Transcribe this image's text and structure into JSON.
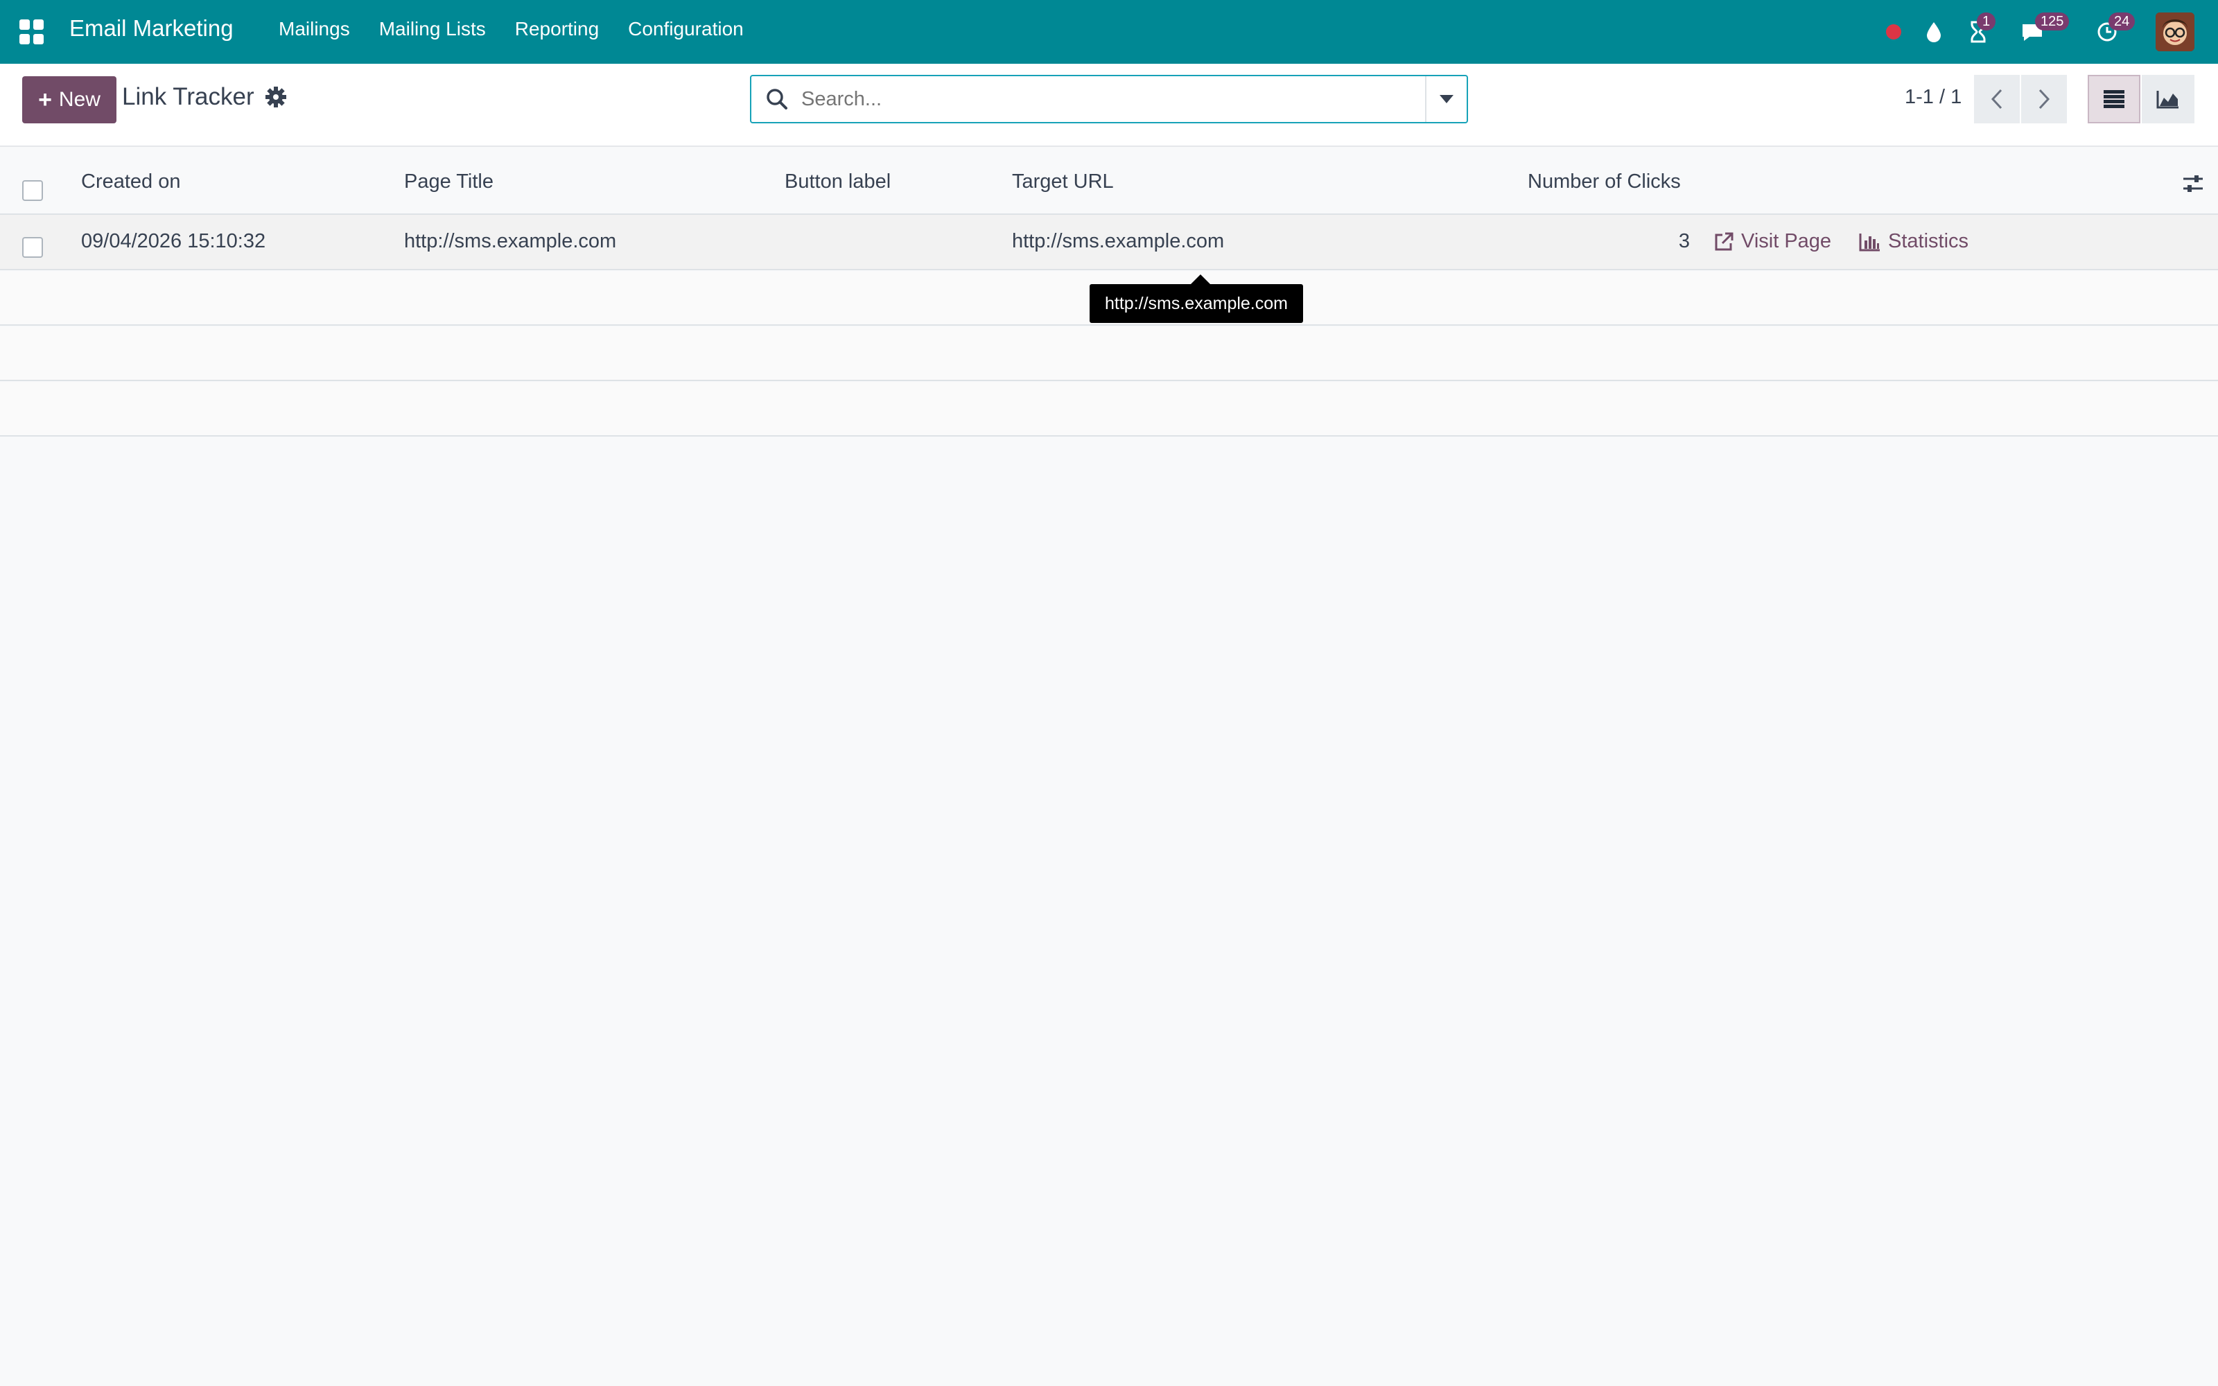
{
  "navbar": {
    "brand": "Email Marketing",
    "menu": [
      "Mailings",
      "Mailing Lists",
      "Reporting",
      "Configuration"
    ],
    "badges": {
      "activities": "1",
      "messages": "125",
      "updates": "24"
    },
    "colors": {
      "bar": "#008894",
      "badge": "#7a3b6e",
      "recording_dot": "#dc3545"
    }
  },
  "control": {
    "new_label": "New",
    "breadcrumb": "Link Tracker",
    "search_placeholder": "Search...",
    "pager": "1-1 / 1"
  },
  "table": {
    "columns": [
      "Created on",
      "Page Title",
      "Button label",
      "Target URL",
      "Number of Clicks"
    ],
    "rows": [
      {
        "created_on": "09/04/2026 15:10:32",
        "page_title": "http://sms.example.com",
        "button_label": "",
        "target_url": "http://sms.example.com",
        "clicks": "3",
        "visit_label": "Visit Page",
        "stats_label": "Statistics"
      }
    ]
  },
  "tooltip": "http://sms.example.com",
  "accent": "#714b67"
}
